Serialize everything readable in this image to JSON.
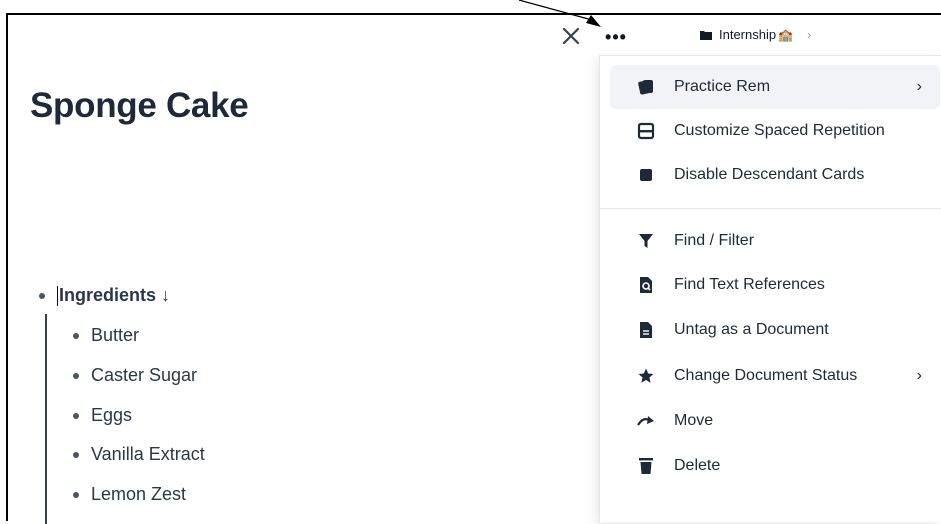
{
  "toolbar": {
    "close_icon": "close-icon",
    "more_label": "•••",
    "breadcrumb": {
      "folder_icon": "folder-icon",
      "label": "Internship",
      "emoji": "🏫",
      "chevron": "›"
    }
  },
  "document": {
    "title": "Sponge Cake",
    "parent_item": "Ingredients ↓",
    "items": [
      "Butter",
      "Caster Sugar",
      "Eggs",
      "Vanilla Extract",
      "Lemon Zest"
    ]
  },
  "menu": {
    "items": [
      {
        "label": "Practice Rem",
        "icon": "cards-icon",
        "has_submenu": true
      },
      {
        "label": "Customize Spaced Repetition",
        "icon": "inbox-icon",
        "has_submenu": false
      },
      {
        "label": "Disable Descendant Cards",
        "icon": "square-icon",
        "has_submenu": false
      },
      {
        "label": "Find / Filter",
        "icon": "filter-icon",
        "has_submenu": false
      },
      {
        "label": "Find Text References",
        "icon": "file-search-icon",
        "has_submenu": false
      },
      {
        "label": "Untag as a Document",
        "icon": "document-icon",
        "has_submenu": false
      },
      {
        "label": "Change Document Status",
        "icon": "star-icon",
        "has_submenu": true
      },
      {
        "label": "Move",
        "icon": "move-arrow-icon",
        "has_submenu": false
      },
      {
        "label": "Delete",
        "icon": "trash-icon",
        "has_submenu": false
      }
    ],
    "submenu_chevron": "›"
  }
}
